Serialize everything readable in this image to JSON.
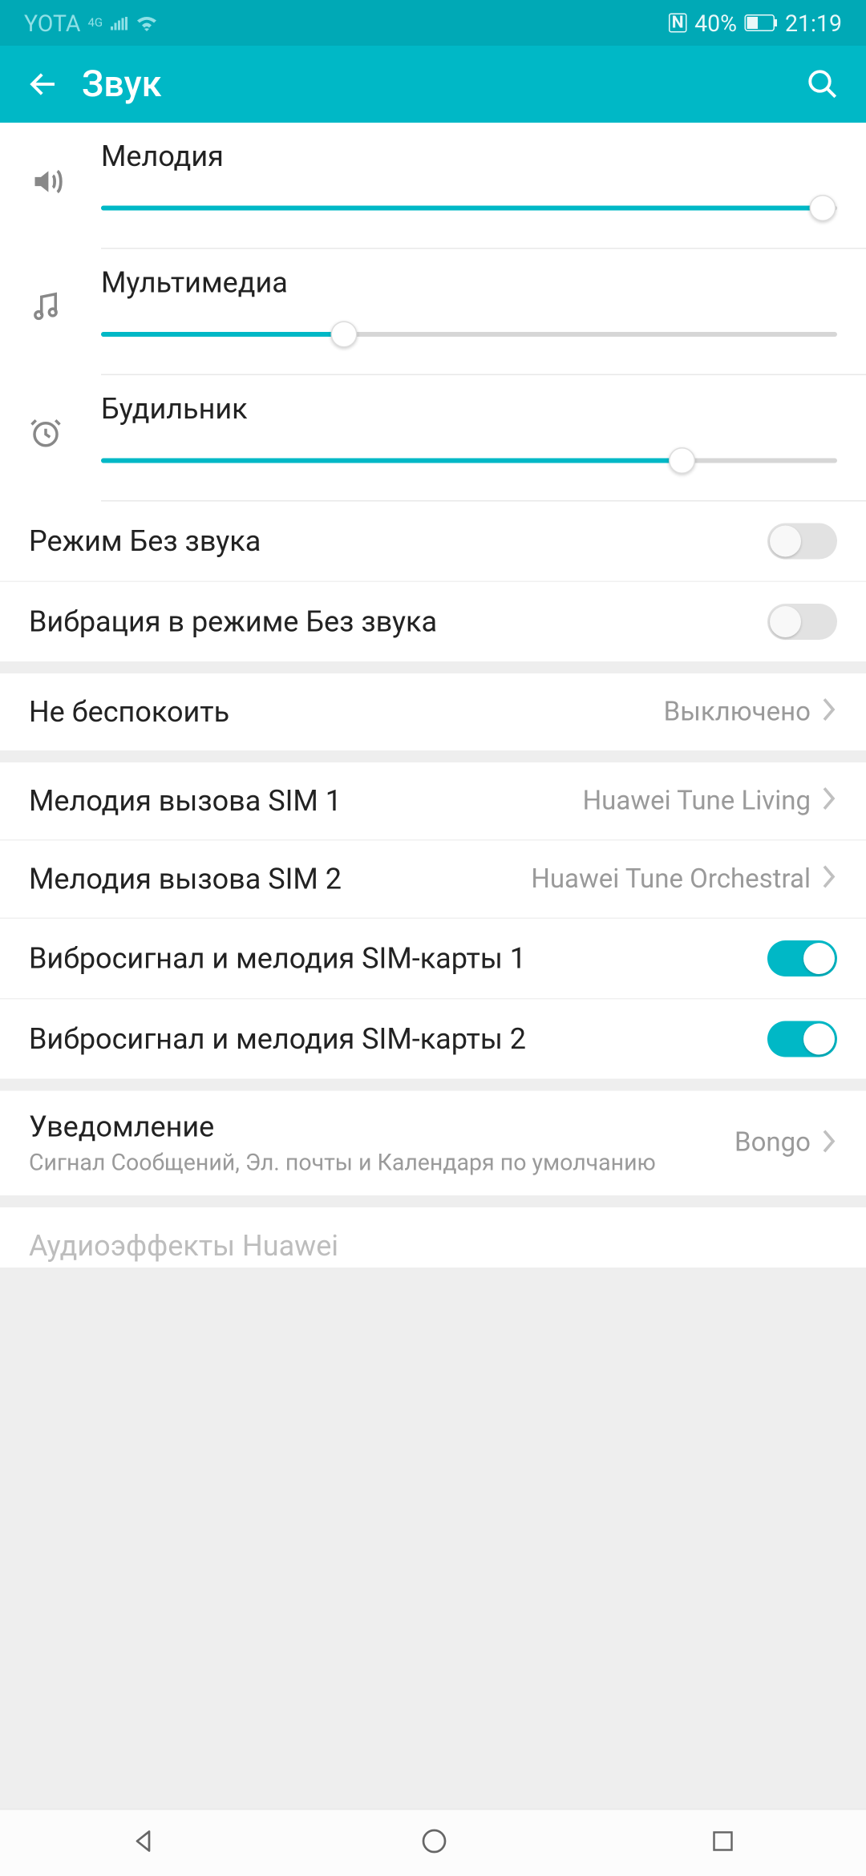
{
  "status": {
    "carrier": "YOTA",
    "signal": "4G",
    "nfc": "N",
    "battery_pct": "40%",
    "time": "21:19"
  },
  "header": {
    "title": "Звук"
  },
  "sliders": {
    "ringtone": {
      "label": "Мелодия",
      "value": 98
    },
    "media": {
      "label": "Мультимедиа",
      "value": 33
    },
    "alarm": {
      "label": "Будильник",
      "value": 79
    }
  },
  "toggles": {
    "silent_mode": {
      "label": "Режим Без звука",
      "on": false
    },
    "vibrate_silent": {
      "label": "Вибрация в режиме Без звука",
      "on": false
    },
    "vibro_sim1": {
      "label": "Вибросигнал и мелодия SIM-карты 1",
      "on": true
    },
    "vibro_sim2": {
      "label": "Вибросигнал и мелодия SIM-карты 2",
      "on": true
    }
  },
  "items": {
    "dnd": {
      "label": "Не беспокоить",
      "value": "Выключено"
    },
    "ringtone_sim1": {
      "label": "Мелодия вызова SIM 1",
      "value": "Huawei Tune Living"
    },
    "ringtone_sim2": {
      "label": "Мелодия вызова SIM 2",
      "value": "Huawei Tune Orchestral"
    },
    "notification": {
      "label": "Уведомление",
      "subtitle": "Сигнал Сообщений, Эл. почты и Календаря по умолчанию",
      "value": "Bongo"
    },
    "audio_effects": {
      "label": "Аудиоэффекты Huawei"
    }
  }
}
